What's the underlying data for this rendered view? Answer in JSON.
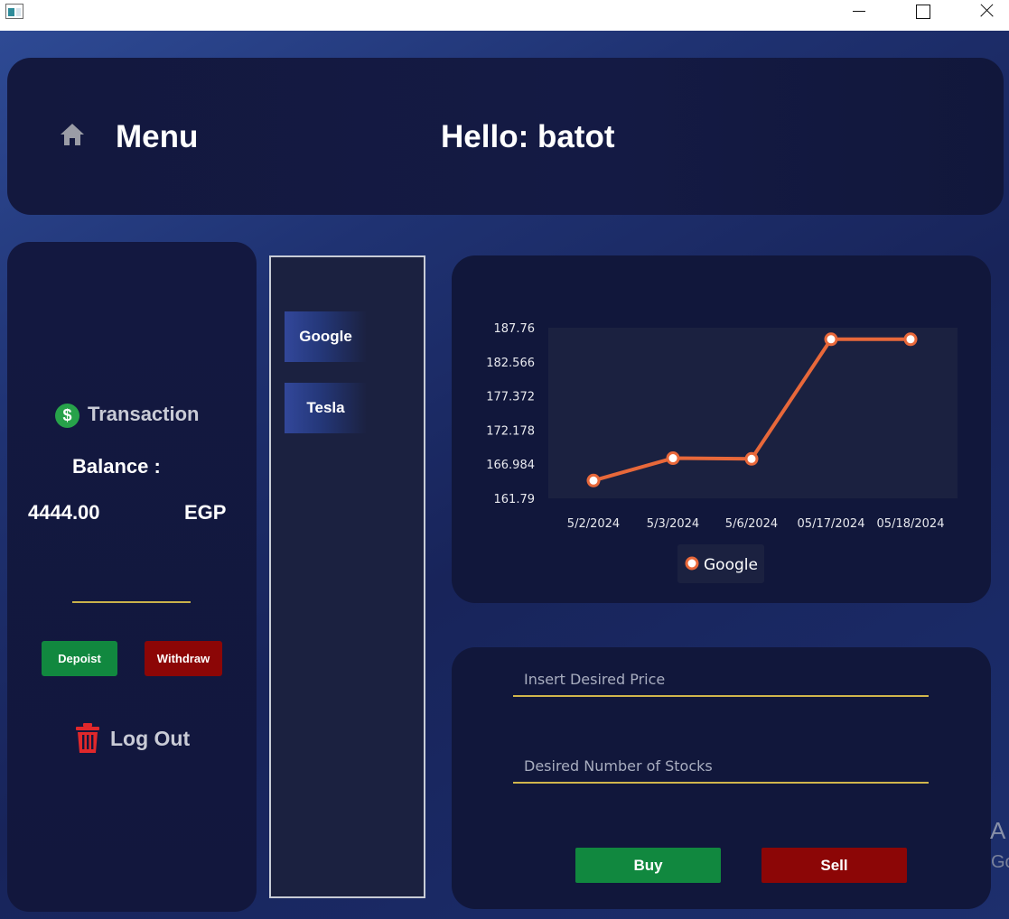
{
  "window": {
    "controls": {
      "minimize_icon": "minimize-icon",
      "maximize_icon": "maximize-icon",
      "close_icon": "close-icon"
    }
  },
  "header": {
    "home_icon": "home-icon",
    "menu_label": "Menu",
    "greeting": "Hello: batot"
  },
  "sidebar": {
    "transaction_icon": "dollar-icon",
    "transaction_label": "Transaction",
    "balance_label": "Balance :",
    "balance_value": "4444.00",
    "currency": "EGP",
    "amount_input_value": "",
    "deposit_label": "Depoist",
    "withdraw_label": "Withdraw",
    "logout_icon": "trash-icon",
    "logout_label": "Log Out"
  },
  "stocks": {
    "items": [
      {
        "label": "Google"
      },
      {
        "label": "Tesla"
      }
    ]
  },
  "chart_data": {
    "type": "line",
    "categories": [
      "5/2/2024",
      "5/3/2024",
      "5/6/2024",
      "05/17/2024",
      "05/18/2024"
    ],
    "series": [
      {
        "name": "Google",
        "values": [
          164.5,
          167.9,
          167.8,
          186.0,
          186.0
        ]
      }
    ],
    "y_ticks": [
      "187.76",
      "182.566",
      "177.372",
      "172.178",
      "166.984",
      "161.79"
    ],
    "ylim": [
      161.79,
      187.76
    ],
    "legend": "bottom",
    "grid": false,
    "colors": {
      "line": "#e8683a",
      "plot_bg": "#1b2140",
      "point_fill": "#ffffff"
    }
  },
  "trade": {
    "price_placeholder": "Insert Desired Price",
    "price_value": "",
    "stocks_placeholder": "Desired Number of Stocks",
    "stocks_value": "",
    "buy_label": "Buy",
    "sell_label": "Sell"
  },
  "watermark": {
    "line1": "A",
    "line2": "Go"
  },
  "colors": {
    "panel_bg": "#11173b",
    "buy_green": "#11883f",
    "sell_red": "#8c0606",
    "accent_underline": "#d1b64c"
  }
}
